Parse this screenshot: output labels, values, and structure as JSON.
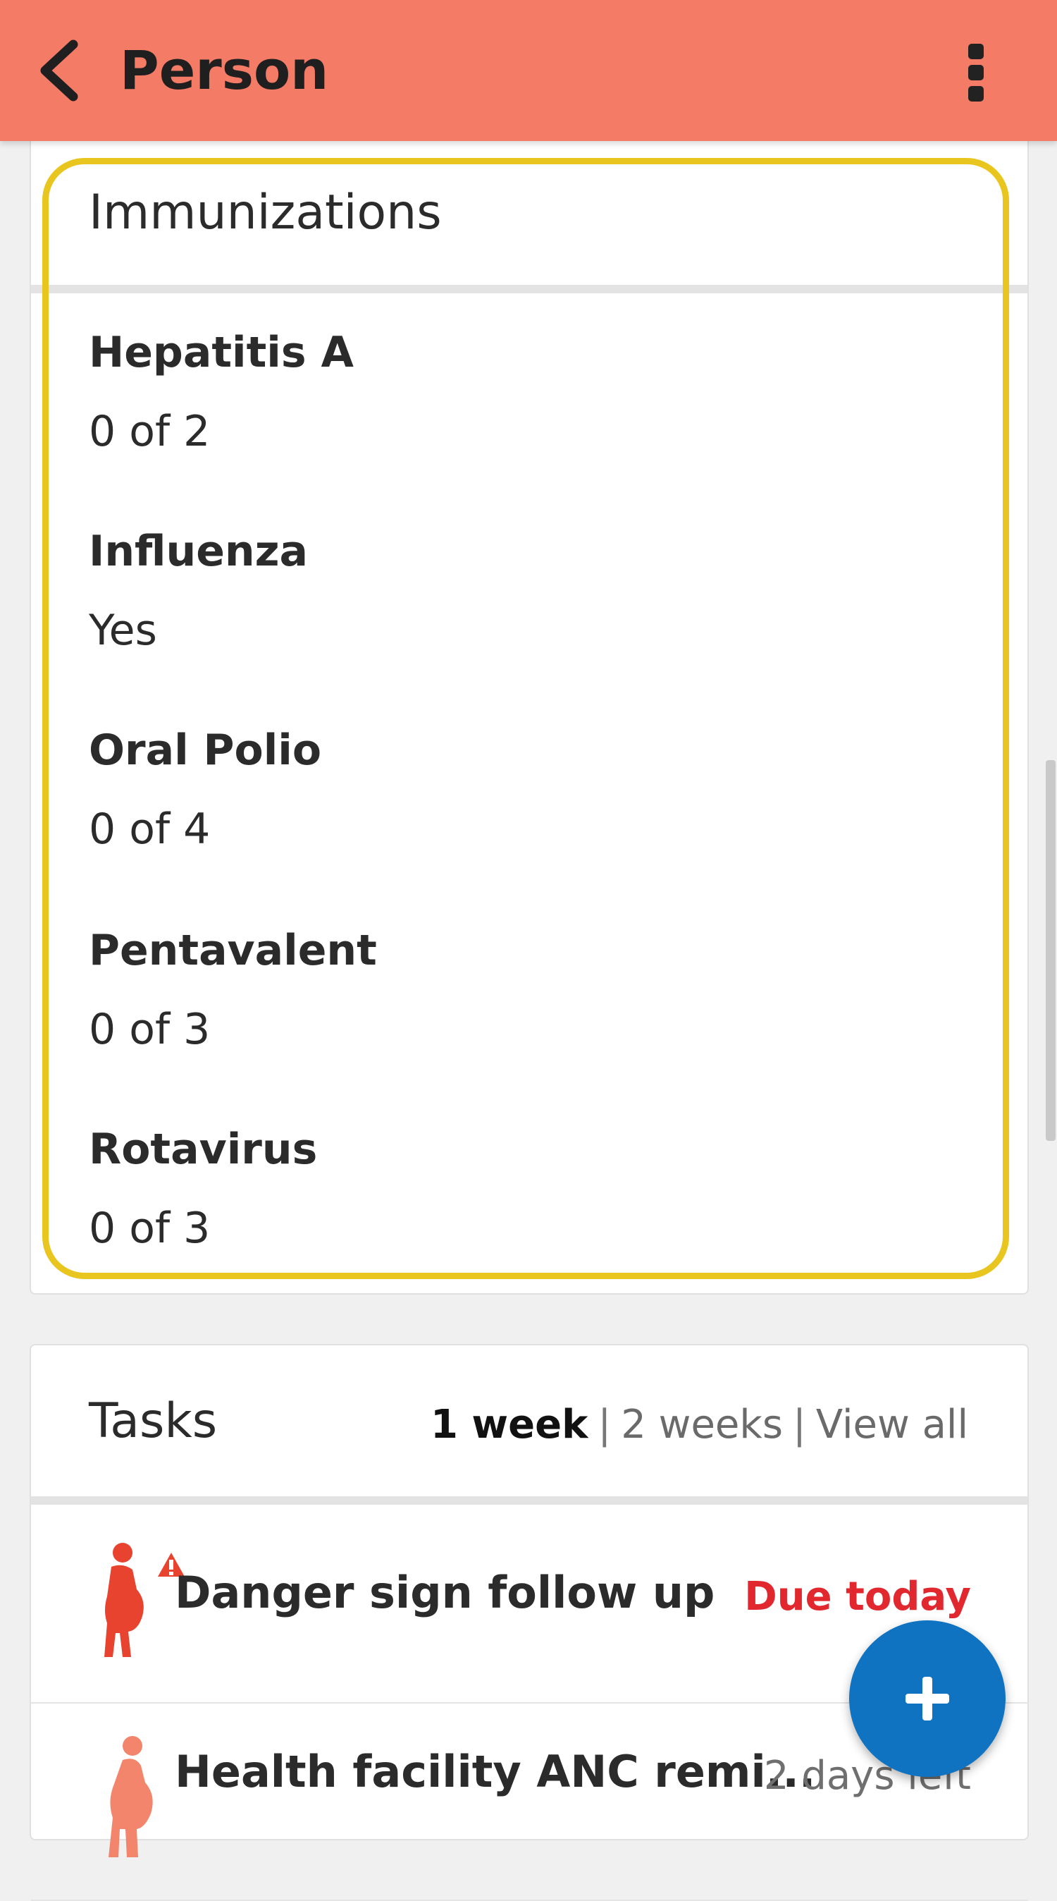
{
  "header": {
    "title": "Person",
    "back_icon": "chevron-left-icon",
    "menu_icon": "more-vert-icon",
    "color": "#f47b66"
  },
  "immunizations": {
    "title": "Immunizations",
    "highlight_color": "#e8c61f",
    "items": [
      {
        "name": "Hepatitis A",
        "value": "0 of 2"
      },
      {
        "name": "Influenza",
        "value": "Yes"
      },
      {
        "name": "Oral Polio",
        "value": "0 of 4"
      },
      {
        "name": "Pentavalent",
        "value": "0 of 3"
      },
      {
        "name": "Rotavirus",
        "value": "0 of 3"
      }
    ]
  },
  "tasks": {
    "title": "Tasks",
    "filters": {
      "one_week": "1 week",
      "sep1": "|",
      "two_weeks": "2 weeks",
      "sep2": "|",
      "view_all": "View all"
    },
    "items": [
      {
        "title": "Danger sign follow up",
        "due": "Due today",
        "icon": "pregnancy-danger-icon",
        "due_color": "#e0282e"
      },
      {
        "title": "Health facility ANC remi...",
        "due": "2 days left",
        "icon": "pregnancy-icon"
      }
    ]
  },
  "fab": {
    "icon": "plus-icon",
    "color": "#0f73c2"
  }
}
